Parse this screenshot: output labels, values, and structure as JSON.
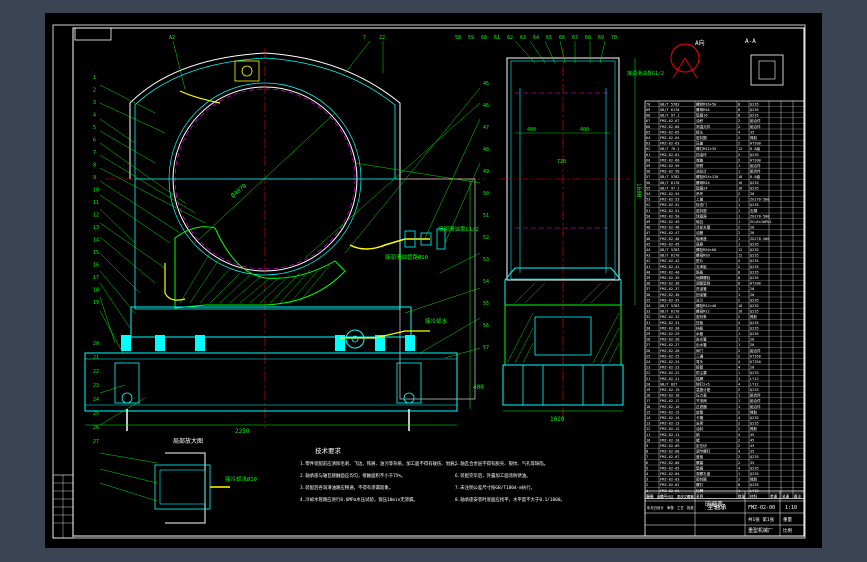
{
  "viewport": {
    "background_color": "#3b4453",
    "sheet_color": "#000000"
  },
  "colors": {
    "frame": "#ffffff",
    "outline": "#00ffff",
    "hatch": "#00ff00",
    "centerline": "#ff0000",
    "hidden": "#ff00ff",
    "leader": "#00ff00",
    "pipe": "#ffff00",
    "text": "#ffffff",
    "dim": "#00ff00"
  },
  "balloons_top_left": [
    "A2",
    "7",
    "22"
  ],
  "balloons_left": [
    "1",
    "2",
    "3",
    "4",
    "5",
    "6",
    "7",
    "8",
    "9",
    "10",
    "11",
    "12",
    "13",
    "14",
    "15",
    "16",
    "17",
    "18",
    "19",
    "20",
    "21",
    "22",
    "23",
    "24",
    "25",
    "26",
    "27"
  ],
  "balloons_mid": [
    "45",
    "46",
    "47",
    "48",
    "49",
    "50",
    "51",
    "52",
    "53",
    "54",
    "55",
    "56",
    "57"
  ],
  "balloons_top_right": [
    "58",
    "59",
    "60",
    "61",
    "62",
    "63",
    "64",
    "65",
    "66",
    "67",
    "68",
    "69",
    "70"
  ],
  "labels": {
    "main_dia": "Ø4070",
    "overall_width": "2250",
    "side_width": "1020",
    "side_height": "1600",
    "inner_height": "720",
    "dim_left": "400",
    "dim_right": "400",
    "pipe_note_1": "接润滑油泵G1/2",
    "pipe_note_2": "接润滑油管路Ø10",
    "pipe_note_3": "接冷却水",
    "detail_title": "局部放大图",
    "detail_note": "接冷却水Ø10",
    "view_title": "A向",
    "view_label": "A向",
    "section_tag": "A-A"
  },
  "tech_title": "技术要求",
  "tech_requirements": [
    "1.零件装配前应清除毛刺、飞边、铁屑、油污等杂质，加工面不得有碰伤、划痕。",
    "2.轴承座与轴瓦接触面应均匀，接触面积不小于75%。",
    "3.装配后各润滑油路应畅通，不得有渗漏现象。",
    "4.冷却水管路应进行0.6MPa水压试验，保压10min无渗漏。",
    "5.轴瓦合金层不得有脱壳、裂纹、气孔等缺陷。",
    "6.装配完毕后，外露加工面涂防锈油。",
    "7.未注明公差尺寸按GB/T1804-m执行。",
    "8.轴承座安装时底面应找平，水平度不大于0.1/1000。"
  ],
  "parts_table": {
    "title": "明细表",
    "columns": [
      "序号",
      "代号",
      "名称",
      "数量",
      "材料",
      "单重",
      "总重",
      "备注"
    ],
    "rows": [
      [
        "70",
        "GB/T 5783",
        "螺栓M16×50",
        "8",
        "Q235",
        "",
        "",
        ""
      ],
      [
        "69",
        "GB/T 6170",
        "螺母M16",
        "8",
        "Q235",
        "",
        "",
        ""
      ],
      [
        "68",
        "GB/T 97.1",
        "垫圈16",
        "8",
        "Q235",
        "",
        "",
        ""
      ],
      [
        "67",
        "FMZ-02-67",
        "油杯",
        "2",
        "组合件",
        "",
        "",
        ""
      ],
      [
        "66",
        "FMZ-02-66",
        "测温元件",
        "2",
        "组合件",
        "",
        "",
        ""
      ],
      [
        "65",
        "FMZ-02-65",
        "接头",
        "4",
        "35",
        "",
        "",
        ""
      ],
      [
        "64",
        "FMZ-02-64",
        "密封圈",
        "2",
        "橡胶",
        "",
        "",
        ""
      ],
      [
        "63",
        "FMZ-02-63",
        "压盖",
        "2",
        "HT200",
        "",
        "",
        ""
      ],
      [
        "62",
        "GB/T 70.1",
        "螺钉M12×35",
        "12",
        "8.8级",
        "",
        "",
        ""
      ],
      [
        "61",
        "FMZ-02-61",
        "挡油环",
        "2",
        "Q235",
        "",
        "",
        ""
      ],
      [
        "60",
        "FMZ-02-60",
        "端盖",
        "2",
        "HT200",
        "",
        "",
        ""
      ],
      [
        "59",
        "FMZ-02-59",
        "视镜",
        "1",
        "组合件",
        "",
        "",
        ""
      ],
      [
        "58",
        "FMZ-02-58",
        "油位计",
        "1",
        "组合件",
        "",
        "",
        ""
      ],
      [
        "57",
        "GB/T 5782",
        "螺栓M24×120",
        "16",
        "8.8级",
        "",
        "",
        ""
      ],
      [
        "56",
        "GB/T 6170",
        "螺母M24",
        "16",
        "Q235",
        "",
        "",
        ""
      ],
      [
        "55",
        "GB/T 97.1",
        "垫圈24",
        "16",
        "Q235",
        "",
        "",
        ""
      ],
      [
        "54",
        "FMZ-02-54",
        "吊环",
        "2",
        "20",
        "",
        "",
        ""
      ],
      [
        "53",
        "FMZ-02-53",
        "上盖",
        "1",
        "ZG270-500",
        "",
        "",
        ""
      ],
      [
        "52",
        "FMZ-02-52",
        "检查门",
        "1",
        "Q235",
        "",
        "",
        ""
      ],
      [
        "51",
        "FMZ-02-51",
        "密封垫",
        "1",
        "石棉",
        "",
        "",
        ""
      ],
      [
        "50",
        "FMZ-02-50",
        "球面座",
        "1",
        "ZG270-500",
        "",
        "",
        ""
      ],
      [
        "49",
        "FMZ-02-49",
        "轴瓦",
        "1",
        "ZCuSn10Pb1",
        "",
        "",
        ""
      ],
      [
        "48",
        "FMZ-02-48",
        "冷却水管",
        "2",
        "20",
        "",
        "",
        ""
      ],
      [
        "47",
        "FMZ-02-47",
        "油管",
        "2",
        "20",
        "",
        "",
        ""
      ],
      [
        "46",
        "FMZ-02-46",
        "轴承座",
        "1",
        "ZG270-500",
        "",
        "",
        ""
      ],
      [
        "45",
        "FMZ-02-45",
        "底座",
        "1",
        "Q235",
        "",
        "",
        ""
      ],
      [
        "44",
        "GB/T 5783",
        "螺栓M20×60",
        "12",
        "Q235",
        "",
        "",
        ""
      ],
      [
        "43",
        "GB/T 6170",
        "螺母M20",
        "12",
        "Q235",
        "",
        "",
        ""
      ],
      [
        "42",
        "FMZ-02-42",
        "垫片",
        "4",
        "Q235",
        "",
        "",
        ""
      ],
      [
        "41",
        "FMZ-02-41",
        "支承板",
        "2",
        "Q235",
        "",
        "",
        ""
      ],
      [
        "40",
        "FMZ-02-40",
        "筋板",
        "8",
        "Q235",
        "",
        "",
        ""
      ],
      [
        "39",
        "FMZ-02-39",
        "地脚螺栓",
        "8",
        "Q235",
        "",
        "",
        ""
      ],
      [
        "38",
        "FMZ-02-38",
        "调整垫铁",
        "8",
        "HT200",
        "",
        "",
        ""
      ],
      [
        "37",
        "FMZ-02-37",
        "进油管",
        "1",
        "20",
        "",
        "",
        ""
      ],
      [
        "36",
        "FMZ-02-36",
        "回油管",
        "1",
        "20",
        "",
        "",
        ""
      ],
      [
        "35",
        "FMZ-02-35",
        "法兰",
        "2",
        "Q235",
        "",
        "",
        ""
      ],
      [
        "34",
        "GB/T 5783",
        "螺栓M12×40",
        "16",
        "Q235",
        "",
        "",
        ""
      ],
      [
        "33",
        "GB/T 6170",
        "螺母M12",
        "16",
        "Q235",
        "",
        "",
        ""
      ],
      [
        "32",
        "FMZ-02-32",
        "密封条",
        "2",
        "橡胶",
        "",
        "",
        ""
      ],
      [
        "31",
        "FMZ-02-31",
        "压板",
        "4",
        "Q235",
        "",
        "",
        ""
      ],
      [
        "30",
        "FMZ-02-30",
        "挡板",
        "2",
        "Q235",
        "",
        "",
        ""
      ],
      [
        "29",
        "FMZ-02-29",
        "水套",
        "1",
        "Q235",
        "",
        "",
        ""
      ],
      [
        "28",
        "FMZ-02-28",
        "进水管",
        "1",
        "20",
        "",
        "",
        ""
      ],
      [
        "27",
        "FMZ-02-27",
        "出水管",
        "1",
        "20",
        "",
        "",
        ""
      ],
      [
        "26",
        "FMZ-02-26",
        "阀门",
        "2",
        "组合件",
        "",
        "",
        ""
      ],
      [
        "25",
        "FMZ-02-25",
        "三通",
        "2",
        "KT350",
        "",
        "",
        ""
      ],
      [
        "24",
        "FMZ-02-24",
        "弯头",
        "4",
        "KT350",
        "",
        "",
        ""
      ],
      [
        "23",
        "FMZ-02-23",
        "接管",
        "4",
        "20",
        "",
        "",
        ""
      ],
      [
        "22",
        "FMZ-02-22",
        "防尘罩",
        "1",
        "Q235",
        "",
        "",
        ""
      ],
      [
        "21",
        "FMZ-02-21",
        "铭牌",
        "1",
        "LY12",
        "",
        "",
        ""
      ],
      [
        "20",
        "GB/T 827",
        "铆钉2×5",
        "4",
        "LY12",
        "",
        "",
        ""
      ],
      [
        "19",
        "FMZ-02-19",
        "温度计座",
        "2",
        "Q235",
        "",
        "",
        ""
      ],
      [
        "18",
        "FMZ-02-18",
        "压力表",
        "1",
        "组合件",
        "",
        "",
        ""
      ],
      [
        "17",
        "FMZ-02-17",
        "节流阀",
        "1",
        "组合件",
        "",
        "",
        ""
      ],
      [
        "16",
        "FMZ-02-16",
        "过滤器",
        "1",
        "组合件",
        "",
        "",
        ""
      ],
      [
        "15",
        "FMZ-02-15",
        "软管",
        "2",
        "橡胶",
        "",
        "",
        ""
      ],
      [
        "14",
        "FMZ-02-14",
        "卡箍",
        "4",
        "Q235",
        "",
        "",
        ""
      ],
      [
        "13",
        "FMZ-02-13",
        "支架",
        "2",
        "Q235",
        "",
        "",
        ""
      ],
      [
        "12",
        "FMZ-02-12",
        "油封",
        "2",
        "橡胶",
        "",
        "",
        ""
      ],
      [
        "11",
        "FMZ-02-11",
        "销",
        "4",
        "45",
        "",
        "",
        ""
      ],
      [
        "10",
        "FMZ-02-10",
        "键",
        "2",
        "45",
        "",
        "",
        ""
      ],
      [
        "9",
        "FMZ-02-09",
        "定位块",
        "2",
        "45",
        "",
        "",
        ""
      ],
      [
        "8",
        "FMZ-02-08",
        "调节螺钉",
        "4",
        "35",
        "",
        "",
        ""
      ],
      [
        "7",
        "FMZ-02-07",
        "盖板",
        "2",
        "Q235",
        "",
        "",
        ""
      ],
      [
        "6",
        "FMZ-02-06",
        "螺塞",
        "2",
        "35",
        "",
        "",
        ""
      ],
      [
        "5",
        "FMZ-02-05",
        "垫圈",
        "4",
        "Q235",
        "",
        "",
        ""
      ],
      [
        "4",
        "FMZ-02-04",
        "观察孔盖",
        "1",
        "Q235",
        "",
        "",
        ""
      ],
      [
        "3",
        "FMZ-02-03",
        "密封圈",
        "2",
        "橡胶",
        "",
        "",
        ""
      ],
      [
        "2",
        "FMZ-02-02",
        "螺钉",
        "8",
        "Q235",
        "",
        "",
        ""
      ],
      [
        "1",
        "FMZ-02-01",
        "标牌",
        "1",
        "LY12",
        "",
        "",
        ""
      ]
    ]
  },
  "title_block": {
    "drawing_name": "主轴承",
    "drawing_no": "FMZ-02-00",
    "scale": "1:10",
    "sheet": "共1张 第1张",
    "company": "重型机械厂",
    "rows": [
      "标记",
      "处数",
      "分区",
      "更改文件号",
      "签名",
      "年月日",
      "设计",
      "审核",
      "工艺",
      "批准"
    ],
    "weight": "重量",
    "ratio": "比例"
  }
}
